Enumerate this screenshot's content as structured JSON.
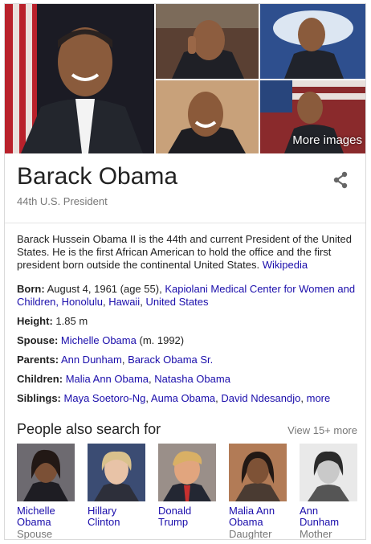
{
  "images": {
    "more_images_label": "More images"
  },
  "header": {
    "title": "Barack Obama",
    "subtitle": "44th U.S. President"
  },
  "description": {
    "text": "Barack Hussein Obama II is the 44th and current President of the United States. He is the first African American to hold the office and the first president born outside the continental United States.",
    "source_link": "Wikipedia"
  },
  "facts": {
    "born": {
      "label": "Born:",
      "date": "August 4, 1961 (age 55),",
      "place_1": "Kapiolani Medical Center for Women and Children, Honolulu",
      "place_2": "Hawaii",
      "place_3": "United States"
    },
    "height": {
      "label": "Height:",
      "value": "1.85 m"
    },
    "spouse": {
      "label": "Spouse:",
      "name": "Michelle Obama",
      "extra": "(m. 1992)"
    },
    "parents": {
      "label": "Parents:",
      "p1": "Ann Dunham",
      "p2": "Barack Obama Sr."
    },
    "children": {
      "label": "Children:",
      "c1": "Malia Ann Obama",
      "c2": "Natasha Obama"
    },
    "siblings": {
      "label": "Siblings:",
      "s1": "Maya Soetoro-Ng",
      "s2": "Auma Obama",
      "s3": "David Ndesandjo",
      "more": "more"
    }
  },
  "people_also_search": {
    "title": "People also search for",
    "view_more": "View 15+ more",
    "people": [
      {
        "line1": "Michelle",
        "line2": "Obama",
        "role": "Spouse"
      },
      {
        "line1": "Hillary",
        "line2": "Clinton",
        "role": ""
      },
      {
        "line1": "Donald",
        "line2": "Trump",
        "role": ""
      },
      {
        "line1": "Malia Ann",
        "line2": "Obama",
        "role": "Daughter"
      },
      {
        "line1": "Ann",
        "line2": "Dunham",
        "role": "Mother"
      }
    ]
  }
}
